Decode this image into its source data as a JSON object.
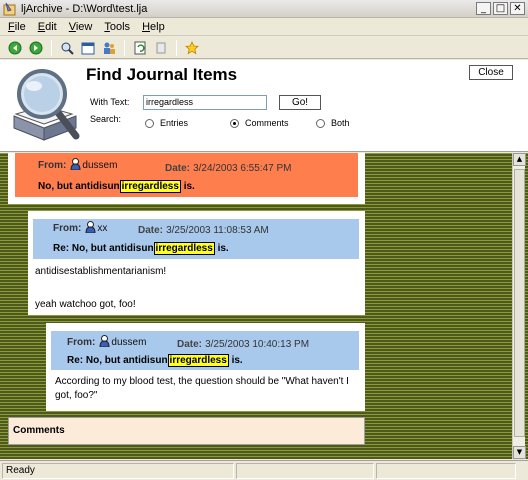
{
  "window": {
    "title": "ljArchive - D:\\Word\\test.lja",
    "min": "_",
    "max": "□",
    "close": "✕"
  },
  "menu": [
    {
      "u": "F",
      "rest": "ile"
    },
    {
      "u": "E",
      "rest": "dit"
    },
    {
      "u": "V",
      "rest": "iew"
    },
    {
      "u": "T",
      "rest": "ools"
    },
    {
      "u": "H",
      "rest": "elp"
    }
  ],
  "panel": {
    "title": "Find Journal Items",
    "close_label": "Close",
    "with_text_label": "With Text:",
    "search_value": "irregardless",
    "go_label": "Go!",
    "search_label": "Search:",
    "options": {
      "entries": "Entries",
      "comments": "Comments",
      "both": "Both"
    },
    "selected": "comments"
  },
  "comments": [
    {
      "from_label": "From:",
      "user": "dussem",
      "date_label": "Date:",
      "date": "3/24/2003 6:55:47 PM",
      "subj_pre": "No, but antidisun",
      "subj_hl": "irregardless",
      "subj_post": " is."
    },
    {
      "from_label": "From:",
      "user": "xx",
      "date_label": "Date:",
      "date": "3/25/2003 11:08:53 AM",
      "subj_pre": "Re: No, but antidisun",
      "subj_hl": "irregardless",
      "subj_post": " is.",
      "body1": "antidisestablishmentarianism!",
      "body2": "yeah watchoo got, foo!"
    },
    {
      "from_label": "From:",
      "user": "dussem",
      "date_label": "Date:",
      "date": "3/25/2003 10:40:13 PM",
      "subj_pre": "Re: No, but antidisun",
      "subj_hl": "irregardless",
      "subj_post": " is.",
      "body1": "According to my blood test, the question should be \"What haven't I got, foo?\""
    }
  ],
  "comments_footer": "Comments",
  "status": {
    "text": "Ready"
  },
  "colors": {
    "orange_header": "#fe7e4e",
    "blue_header": "#a8c8ec",
    "highlight": "#ffff22",
    "footer": "#fdebd9"
  }
}
